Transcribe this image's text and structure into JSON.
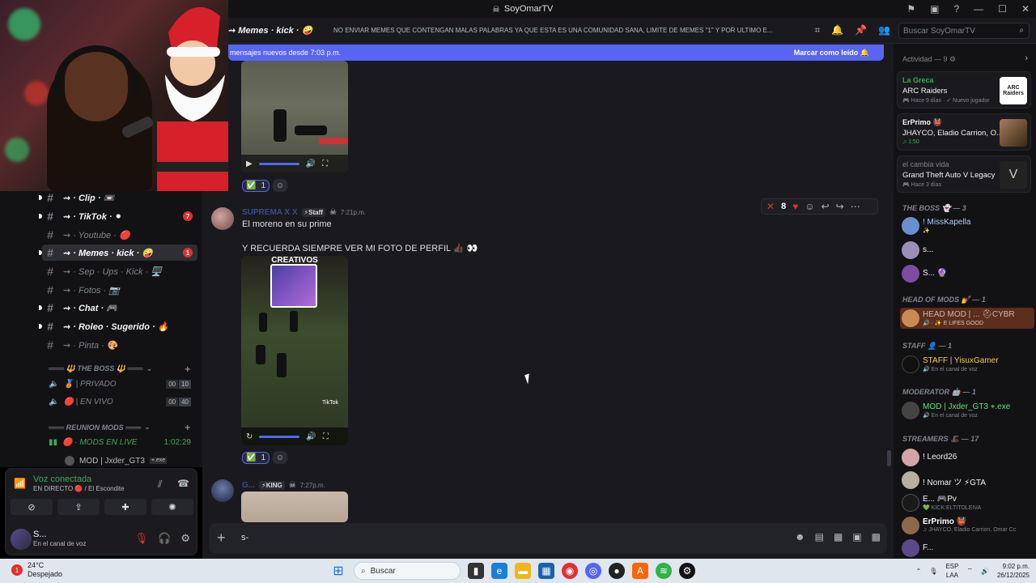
{
  "window": {
    "title": "SoyOmarTV",
    "controls": [
      "—",
      "☐",
      "✕"
    ]
  },
  "header": {
    "channel_name": "⇝ Memes · kick · 🤪",
    "topic": "NO ENVIAR MEMES QUE CONTENGAN MALAS PALABRAS YA QUE ESTA ES UNA COMUNIDAD SANA, LIMITE DE MEMES \"1\" Y POR ULTIMO E...",
    "search_placeholder": "Buscar SoyOmarTV"
  },
  "new_messages_bar": {
    "text": "mensajes nuevos desde 7:03 p.m.",
    "action": "Marcar como leído"
  },
  "sidebar": {
    "channels": [
      {
        "label": "⇝ · Clip · 📼",
        "style": "bold",
        "badge": ""
      },
      {
        "label": "⇝ · TikTok · ⚫",
        "style": "bold",
        "badge": "7"
      },
      {
        "label": "⇝ · Youtube · 🔴",
        "style": "dim",
        "badge": ""
      },
      {
        "label": "⇝ · Memes · kick · 🤪",
        "style": "selected",
        "badge": "1"
      },
      {
        "label": "⇝ · Sep · Ups · Kick · 🖥️",
        "style": "dim",
        "badge": ""
      },
      {
        "label": "⇝ · Fotos · 📷",
        "style": "dim",
        "badge": ""
      },
      {
        "label": "⇝ · Chat · 🎮",
        "style": "bold",
        "badge": ""
      },
      {
        "label": "⇝ · Roleo · Sugerido · 🔥",
        "style": "bold",
        "badge": ""
      },
      {
        "label": "⇝ · Pinta · 🎨",
        "style": "dim",
        "badge": ""
      }
    ],
    "category_boss": "═══ 🔱 THE BOSS 🔱 ═══",
    "voice_channels": [
      {
        "label": "🥉 | PRIVADO",
        "count": "00",
        "limit": "10"
      },
      {
        "label": "🔴 | EN VIVO",
        "count": "00",
        "limit": "40"
      }
    ],
    "category_reunion": "═══ REUNION MODS ═══",
    "live_channel": "🔴 · MODS EN LIVE",
    "live_time": "1:02:29",
    "live_user": "MOD | Jxder_GT3",
    "live_user_tag": "⌖.exe"
  },
  "voice_panel": {
    "status": "Voz conectada",
    "sub": "EN DIRECTO 🔴 / El Escondite"
  },
  "user_panel": {
    "name": "S...",
    "status": "En el canal de voz"
  },
  "messages": [
    {
      "author": "SUPREMA X X",
      "tag": "⚡Staff",
      "time": "7:21p.m.",
      "lines": [
        "El moreno en su prime",
        "Y RECUERDA SIEMPRE VER MI FOTO DE PERFIL 👍🏿 👀"
      ],
      "video_caption": "CREATIVOS",
      "video_watermark": "TikTok",
      "reaction_count": "1"
    },
    {
      "author": "G...",
      "tag": "⚡KING",
      "time": "7:27p.m."
    }
  ],
  "first_reaction_count": "1",
  "hover_toolbar": {
    "count": "8"
  },
  "composer": {
    "text": "s-"
  },
  "members": {
    "activity_title": "Actividad — 9 ⚙",
    "activities": [
      {
        "user": "La Greca",
        "game": "ARC Raiders",
        "sub": "🎮 Hace 9 días · ✓ Nuevo jugador",
        "thumb": "ARC Raiders"
      },
      {
        "user": "ErPrimo 👹",
        "game": "JHAYCO, Eladio Carrion, O...",
        "sub": "♫ 1:50"
      },
      {
        "user": "el cambia vida",
        "game": "Grand Theft Auto V Legacy",
        "sub": "🎮 Hace 3 días"
      }
    ],
    "sections": [
      {
        "title": "THE BOSS 👻 — 3",
        "members": [
          {
            "name": "! MissKapella",
            "sub": "✨"
          },
          {
            "name": "s...",
            "sub": ""
          },
          {
            "name": "S... 🔮",
            "sub": ""
          }
        ]
      },
      {
        "title": "HEAD OF MODS 💅 — 1",
        "members": [
          {
            "name": "HEAD MOD | ... ⛑CYBR",
            "sub": "🔊 · ✨ E LIFES GOOD"
          }
        ]
      },
      {
        "title": "STAFF 👤 — 1",
        "members": [
          {
            "name": "STAFF | YisuxGamer",
            "sub": "🔊 En el canal de voz"
          }
        ]
      },
      {
        "title": "MODERATOR 🤖 — 1",
        "members": [
          {
            "name": "MOD | Jxder_GT3 ⌖.exe",
            "sub": "🔊 En el canal de voz"
          }
        ]
      },
      {
        "title": "STREAMERS 🎩 — 17",
        "members": [
          {
            "name": "! Leord26",
            "sub": ""
          },
          {
            "name": "! Nomar ツ ⚡GTA",
            "sub": ""
          },
          {
            "name": "E... 🎮Pv",
            "sub": "💚 KICK:ELTITOLEIVA"
          },
          {
            "name": "ErPrimo 👹",
            "sub": "♫ JHAYCO, Eladio Carrion, Omar Cc"
          },
          {
            "name": "F...",
            "sub": ""
          }
        ]
      }
    ]
  },
  "taskbar": {
    "temp": "24°C",
    "weather": "Despejado",
    "search": "Buscar",
    "lang": "ESP",
    "lang2": "LAA",
    "time": "9:02 p.m.",
    "date": "26/12/2025"
  },
  "colors": {
    "accent": "#5865f2",
    "online": "#43a25a",
    "danger": "#e0312b"
  }
}
